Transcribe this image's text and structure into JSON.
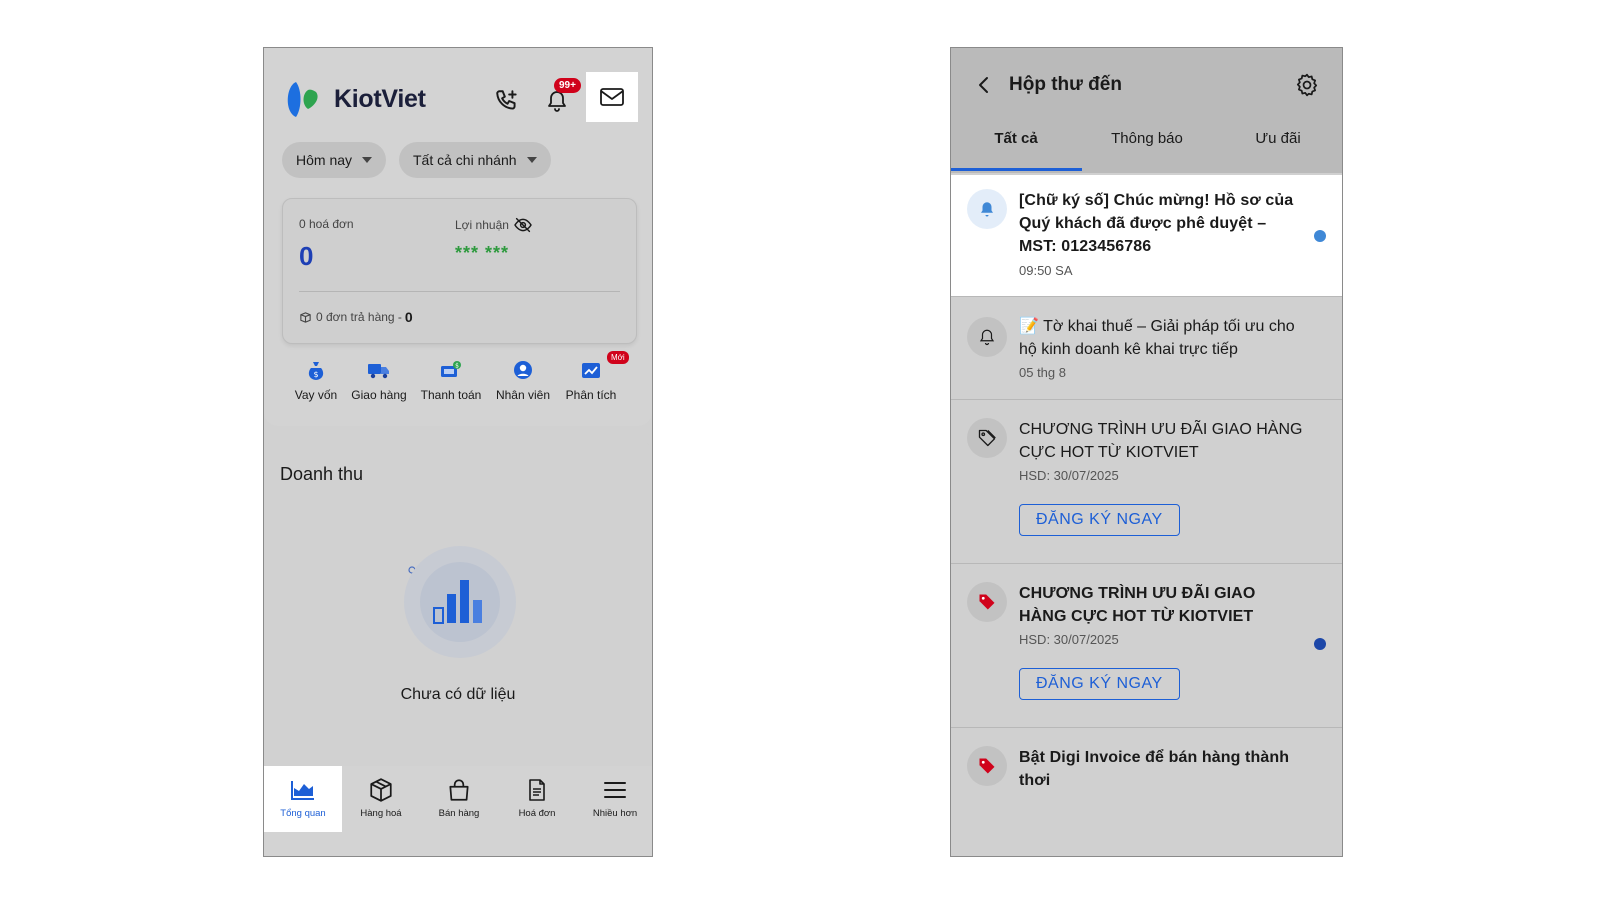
{
  "left": {
    "brand": "KiotViet",
    "notifications_badge": "99+",
    "filters": {
      "period": "Hôm nay",
      "branch": "Tất cả chi nhánh"
    },
    "stats": {
      "invoices_label": "0 hoá đơn",
      "invoices_value": "0",
      "profit_label": "Lợi nhuận",
      "profit_value": "*** ***",
      "returns_label": "0 đơn trả hàng -",
      "returns_value": "0"
    },
    "quick_actions": [
      {
        "label": "Vay vốn",
        "icon": "money-bag-icon"
      },
      {
        "label": "Giao hàng",
        "icon": "truck-icon"
      },
      {
        "label": "Thanh toán",
        "icon": "payment-icon"
      },
      {
        "label": "Nhân viên",
        "icon": "employee-icon"
      },
      {
        "label": "Phân tích",
        "icon": "analytics-icon"
      }
    ],
    "new_badge": "Mới",
    "revenue": {
      "title": "Doanh thu",
      "empty_text": "Chưa có dữ liệu"
    },
    "bottom_nav": [
      {
        "label": "Tổng quan",
        "icon": "chart-area-icon",
        "active": true
      },
      {
        "label": "Hàng hoá",
        "icon": "box-icon"
      },
      {
        "label": "Bán hàng",
        "icon": "shopping-bag-icon"
      },
      {
        "label": "Hoá đơn",
        "icon": "document-icon"
      },
      {
        "label": "Nhiều hơn",
        "icon": "menu-icon"
      }
    ],
    "colors": {
      "accent": "#1d5fd6",
      "badge": "#d0021b",
      "profit": "#2e9a3e"
    }
  },
  "right": {
    "title": "Hộp thư đến",
    "tabs": [
      {
        "label": "Tất cả",
        "active": true
      },
      {
        "label": "Thông báo"
      },
      {
        "label": "Ưu đãi"
      }
    ],
    "messages": [
      {
        "text": "[Chữ ký số] Chúc mừng! Hồ sơ của Quý khách đã được phê duyệt – MST: 0123456786",
        "time": "09:50 SA",
        "icon": "bell-filled-icon",
        "unread": true
      },
      {
        "text": "📝 Tờ khai thuế – Giải pháp tối ưu cho hộ kinh doanh kê khai trực tiếp",
        "time": "05 thg 8",
        "icon": "bell-outline-icon",
        "unread": false
      },
      {
        "text": "CHƯƠNG TRÌNH ƯU ĐÃI GIAO HÀNG CỰC HOT TỪ KIOTVIET",
        "time": "HSD: 30/07/2025",
        "cta": "ĐĂNG KÝ NGAY",
        "icon": "tag-outline-icon",
        "unread": false
      },
      {
        "text": "CHƯƠNG TRÌNH ƯU ĐÃI GIAO HÀNG CỰC HOT TỪ KIOTVIET",
        "time": "HSD: 30/07/2025",
        "cta": "ĐĂNG KÝ NGAY",
        "icon": "tag-filled-icon",
        "unread": true
      },
      {
        "text": "Bật Digi Invoice để bán hàng thành thơi",
        "icon": "tag-filled-icon",
        "unread": false
      }
    ],
    "colors": {
      "unread_dot_light": "#3f88d6",
      "unread_dot_dark": "#1d47a8",
      "promo_red": "#d0021b"
    }
  }
}
